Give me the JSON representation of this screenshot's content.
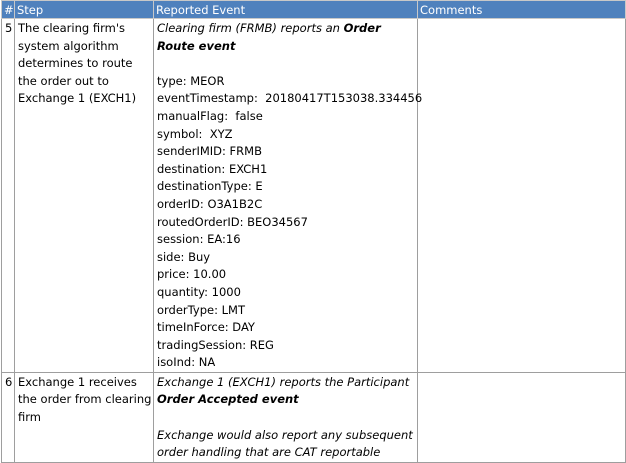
{
  "headers": [
    "#",
    "Step",
    "Reported Event",
    "Comments"
  ],
  "rows": [
    {
      "num": "5",
      "step": "The clearing firm's system algorithm determines to route the order out to Exchange 1 (EXCH1)",
      "event_prefix": "Clearing firm (FRMB) reports an ",
      "event_bold": "Order Route event",
      "fields": [
        "type: MEOR",
        "eventTimestamp:  20180417T153038.334456",
        "manualFlag:  false",
        "symbol:  XYZ",
        "senderIMID: FRMB",
        "destination: EXCH1",
        "destinationType: E",
        "orderID: O3A1B2C",
        "routedOrderID: BEO34567",
        "session: EA:16",
        "side: Buy",
        "price: 10.00",
        "quantity: 1000",
        "orderType: LMT",
        "timeInForce: DAY",
        "tradingSession: REG",
        "isoInd: NA"
      ],
      "comments": ""
    },
    {
      "num": "6",
      "step": "Exchange 1 receives the order from clearing firm",
      "event_prefix": "Exchange 1 (EXCH1) reports the Participant ",
      "event_bold": "Order Accepted event",
      "note": "Exchange would also report any subsequent order handling that are CAT reportable",
      "comments": ""
    }
  ]
}
